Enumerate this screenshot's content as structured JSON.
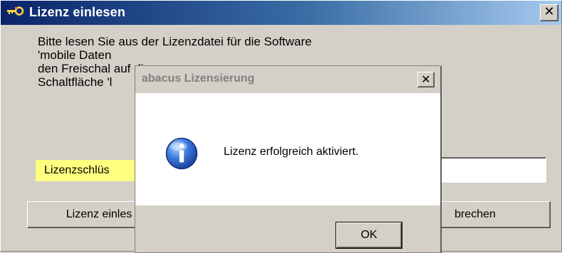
{
  "main_window": {
    "title": "Lizenz einlesen",
    "close_glyph": "✕",
    "icon": "key-icon",
    "instructions": "Bitte lesen Sie aus der Lizenzdatei für die Software\n'mobile Daten\nden Freischal                                                                          auf die\nSchaltfläche 'l",
    "key_label": "Lizenzschlüs",
    "key_value": "",
    "read_button": "Lizenz einles",
    "cancel_button": "brechen"
  },
  "dialog": {
    "title": "abacus Lizensierung",
    "close_glyph": "✕",
    "icon": "info-icon",
    "message": "Lizenz erfolgreich aktiviert.",
    "ok_button": "OK"
  },
  "colors": {
    "title_gradient_start": "#0a246a",
    "title_gradient_end": "#a6caf0",
    "key_label_bg": "#ffff80",
    "dialog_title_text": "#808080"
  }
}
